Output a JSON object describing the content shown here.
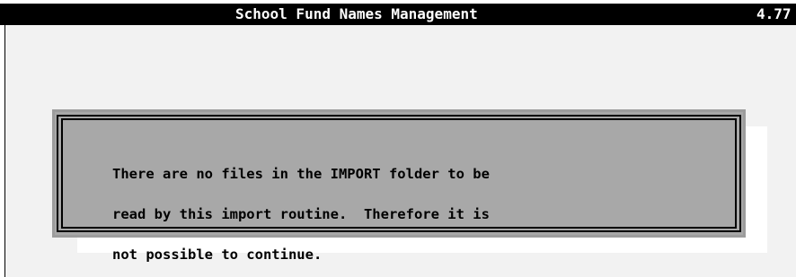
{
  "title_bar": {
    "title": "School Fund Names Management",
    "version": "4.77"
  },
  "dialog": {
    "message_lines": [
      "There are no files in the IMPORT folder to be",
      "read by this import routine.  Therefore it is",
      "not possible to continue."
    ]
  },
  "colors": {
    "title_bar_background": "#000000",
    "title_bar_text": "#ffffff",
    "desktop_background": "#f2f2f2",
    "dialog_background": "#a8a8a8",
    "dialog_border": "#000000"
  }
}
